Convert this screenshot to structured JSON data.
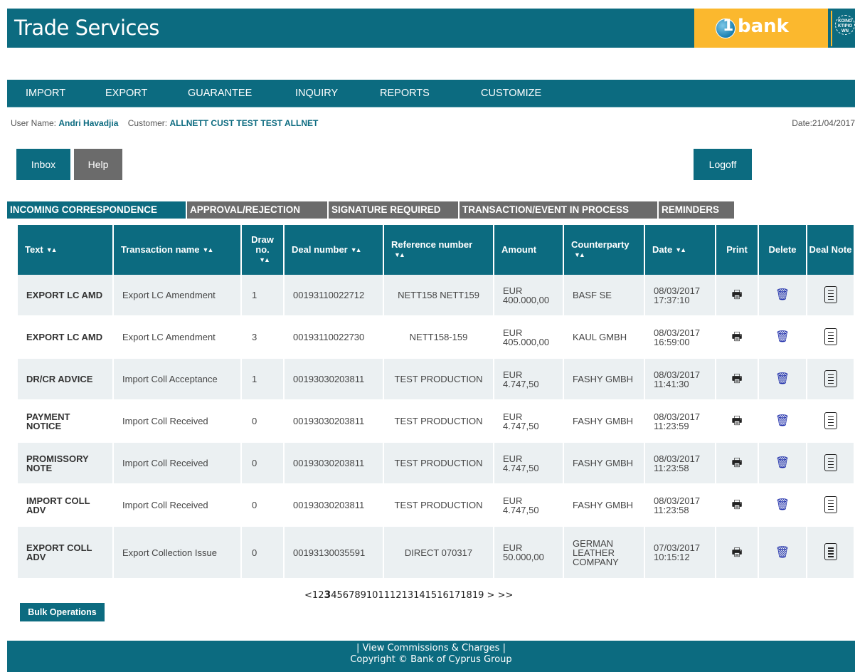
{
  "header": {
    "title": "Trade Services",
    "brand": "bank",
    "brand_numeral": "1",
    "seal_text": "KOINO KTIPIO WN"
  },
  "nav": [
    "IMPORT",
    "EXPORT",
    "GUARANTEE",
    "INQUIRY",
    "REPORTS",
    "CUSTOMIZE"
  ],
  "user": {
    "user_label": "User Name:",
    "user_name": "Andri Havadjia",
    "customer_label": "Customer:",
    "customer_name": "ALLNETT CUST TEST TEST ALLNET",
    "date": "Date:21/04/2017"
  },
  "buttons": {
    "inbox": "Inbox",
    "help": "Help",
    "logoff": "Logoff"
  },
  "tabs": [
    "INCOMING CORRESPONDENCE",
    "APPROVAL/REJECTION",
    "SIGNATURE REQUIRED",
    "TRANSACTION/EVENT IN PROCESS",
    "REMINDERS"
  ],
  "table": {
    "headers": [
      "Text",
      "Transaction name",
      "Draw no.",
      "Deal number",
      "Reference number",
      "Amount",
      "Counterparty",
      "Date",
      "Print",
      "Delete",
      "Deal Note"
    ],
    "rows": [
      [
        "EXPORT LC AMD",
        "Export LC Amendment",
        "1",
        "00193110022712",
        "NETT158 NETT159",
        "EUR 400.000,00",
        "BASF SE",
        "08/03/2017 17:37:10"
      ],
      [
        "EXPORT LC AMD",
        "Export LC Amendment",
        "3",
        "00193110022730",
        "NETT158-159",
        "EUR 405.000,00",
        "KAUL GMBH",
        "08/03/2017 16:59:00"
      ],
      [
        "DR/CR ADVICE",
        "Import Coll Acceptance",
        "1",
        "00193030203811",
        "TEST PRODUCTION",
        "EUR 4.747,50",
        "FASHY GMBH",
        "08/03/2017 11:41:30"
      ],
      [
        "PAYMENT NOTICE",
        "Import Coll Received",
        "0",
        "00193030203811",
        "TEST PRODUCTION",
        "EUR 4.747,50",
        "FASHY GMBH",
        "08/03/2017 11:23:59"
      ],
      [
        "PROMISSORY NOTE",
        "Import Coll Received",
        "0",
        "00193030203811",
        "TEST PRODUCTION",
        "EUR 4.747,50",
        "FASHY GMBH",
        "08/03/2017 11:23:58"
      ],
      [
        "IMPORT COLL ADV",
        "Import Coll Received",
        "0",
        "00193030203811",
        "TEST PRODUCTION",
        "EUR 4.747,50",
        "FASHY GMBH",
        "08/03/2017 11:23:58"
      ],
      [
        "EXPORT COLL ADV",
        "Export Collection Issue",
        "0",
        "00193130035591",
        "DIRECT 070317",
        "EUR 50.000,00",
        "GERMAN LEATHER COMPANY",
        "07/03/2017 10:15:12"
      ]
    ]
  },
  "pager": {
    "first": "<",
    "pages": [
      "1",
      "2",
      "3",
      "4",
      "5",
      "6",
      "7",
      "8",
      "9",
      "10",
      "11",
      "12",
      "13",
      "14",
      "15",
      "16",
      "17",
      "18",
      "19"
    ],
    "current": "3",
    "next": ">",
    "last": ">>"
  },
  "bulk": "Bulk Operations",
  "footer": {
    "link": "| View Commissions & Charges |",
    "copyright": "Copyright © Bank of Cyprus Group"
  },
  "colors": {
    "primary": "#0c6b80",
    "brand": "#fbb82e",
    "inactive": "#6b6b6b",
    "row_alt": "#ebf0f2"
  },
  "icons": {
    "print": "printer-icon",
    "delete": "trash-icon",
    "deal_note": "document-icon"
  }
}
